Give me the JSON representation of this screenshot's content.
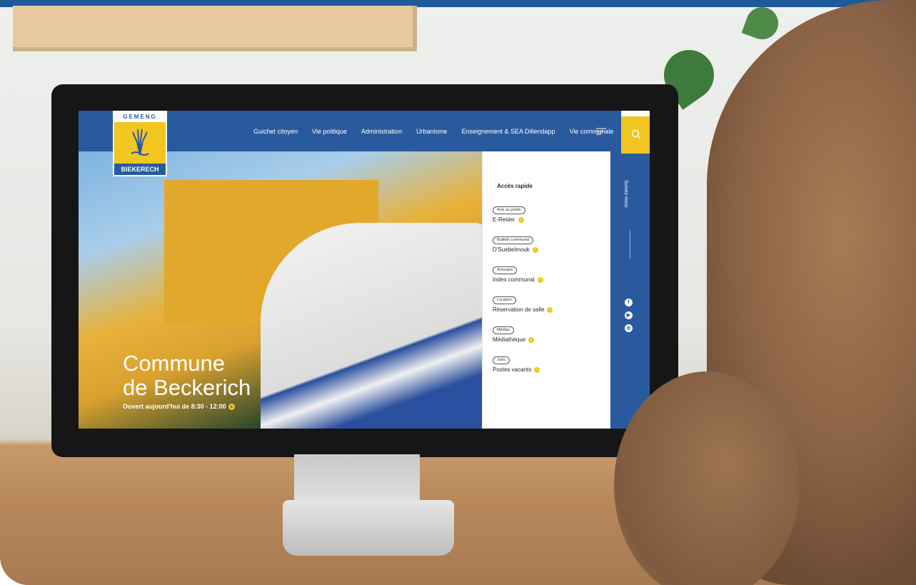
{
  "logo": {
    "top_text": "GEMENG",
    "bottom_text": "BIEKERECH"
  },
  "nav": {
    "items": [
      "Guichet citoyen",
      "Vie politique",
      "Administration",
      "Urbanisme",
      "Enseignement & SEA Dillendapp",
      "Vie communale"
    ]
  },
  "hero": {
    "title_line1": "Commune",
    "title_line2": "de Beckerich",
    "hours": "Ouvert aujourd'hui de 8:30 - 12:00"
  },
  "quick_access": {
    "title": "Accès rapide",
    "items": [
      {
        "tag": "Avis au public",
        "label": "E-Reider"
      },
      {
        "tag": "Bulletin communal",
        "label": "D'Suebelmouk"
      },
      {
        "tag": "Annuaire",
        "label": "Index communal"
      },
      {
        "tag": "Location",
        "label": "Réservation de salle"
      },
      {
        "tag": "Médias",
        "label": "Médiathèque"
      },
      {
        "tag": "Jobs",
        "label": "Postes vacants"
      }
    ]
  },
  "social": {
    "label": "Suivez-nous",
    "icons": [
      "facebook-icon",
      "youtube-icon",
      "instagram-icon"
    ]
  },
  "colors": {
    "brand_blue": "#2a5a9e",
    "brand_yellow": "#f2c620"
  }
}
